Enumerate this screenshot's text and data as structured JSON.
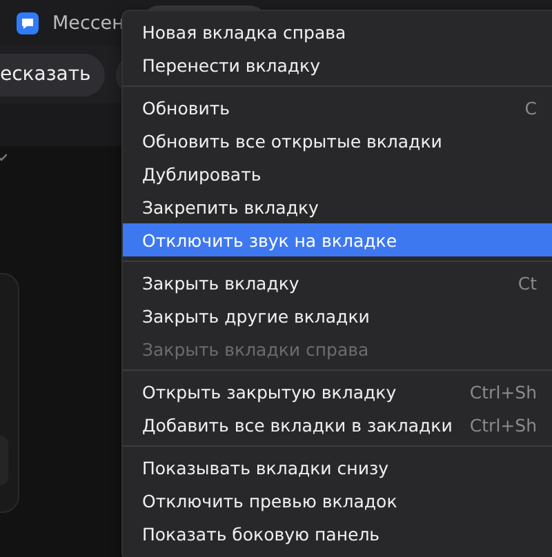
{
  "tab_bar": {
    "tabs": [
      {
        "title": "Мессен",
        "selected": false
      }
    ]
  },
  "toolbar": {
    "pill_text": "есказать"
  },
  "context_menu": {
    "groups": [
      [
        {
          "label": "Новая вкладка справа",
          "selected": false,
          "disabled": false
        },
        {
          "label": "Перенести вкладку",
          "selected": false,
          "disabled": false
        }
      ],
      [
        {
          "label": "Обновить",
          "shortcut": "C",
          "selected": false,
          "disabled": false
        },
        {
          "label": "Обновить все открытые вкладки",
          "selected": false,
          "disabled": false
        },
        {
          "label": "Дублировать",
          "selected": false,
          "disabled": false
        },
        {
          "label": "Закрепить вкладку",
          "selected": false,
          "disabled": false
        },
        {
          "label": "Отключить звук на вкладке",
          "selected": true,
          "disabled": false
        }
      ],
      [
        {
          "label": "Закрыть вкладку",
          "shortcut": "Ct",
          "selected": false,
          "disabled": false
        },
        {
          "label": "Закрыть другие вкладки",
          "selected": false,
          "disabled": false
        },
        {
          "label": "Закрыть вкладки справа",
          "selected": false,
          "disabled": true
        }
      ],
      [
        {
          "label": "Открыть закрытую вкладку",
          "shortcut": "Ctrl+Sh",
          "selected": false,
          "disabled": false
        },
        {
          "label": "Добавить все вкладки в закладки",
          "shortcut": "Ctrl+Sh",
          "selected": false,
          "disabled": false
        }
      ],
      [
        {
          "label": "Показывать вкладки снизу",
          "selected": false,
          "disabled": false
        },
        {
          "label": "Отключить превью вкладок",
          "selected": false,
          "disabled": false
        },
        {
          "label": "Показать боковую панель",
          "selected": false,
          "disabled": false
        }
      ]
    ]
  }
}
